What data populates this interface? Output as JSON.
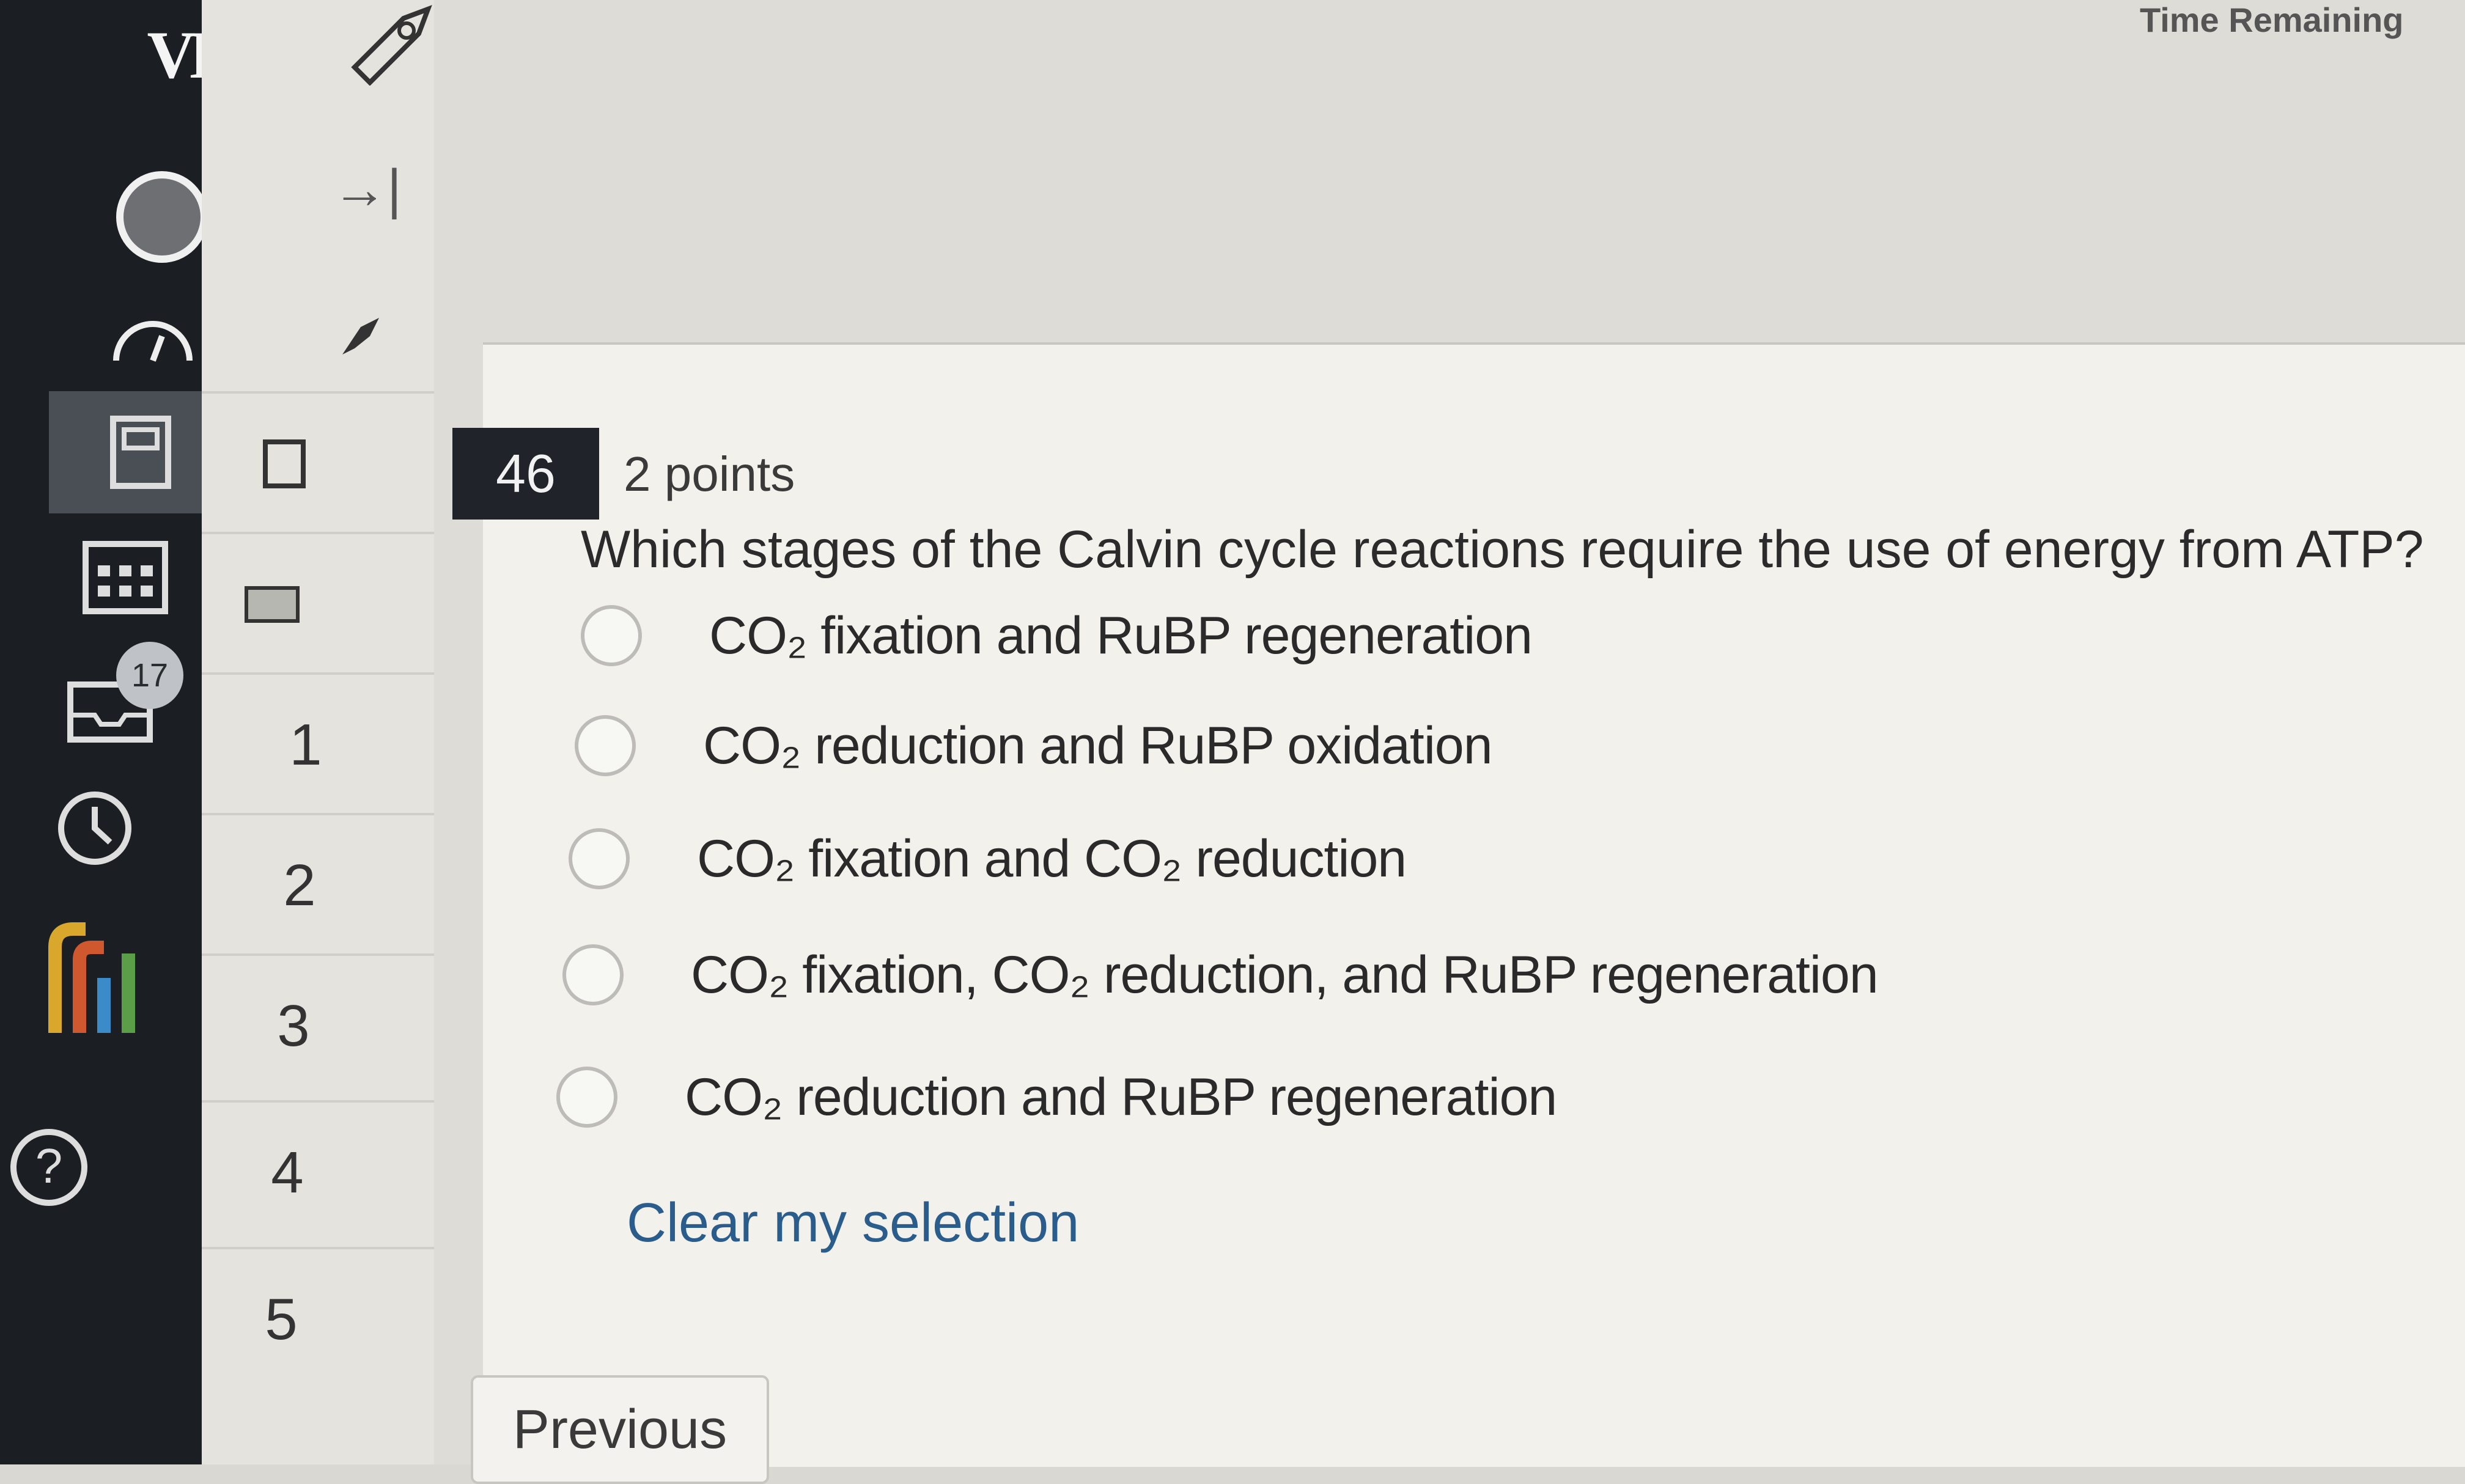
{
  "header": {
    "time_remaining_label": "Time Remaining"
  },
  "global_nav": {
    "logo_text": "VD",
    "inbox_badge_count": "17"
  },
  "course_nav": {
    "collapse_symbol": "→|",
    "question_numbers": [
      "1",
      "2",
      "3",
      "4",
      "5"
    ]
  },
  "question": {
    "number": "46",
    "points": "2 points",
    "text": "Which stages of the Calvin cycle reactions require the use of energy from ATP?",
    "answers": [
      "CO₂ fixation and RuBP regeneration",
      "CO₂ reduction and RuBP oxidation",
      "CO₂ fixation and CO₂ reduction",
      "CO₂ fixation, CO₂ reduction, and RuBP regeneration",
      "CO₂ reduction and RuBP regeneration"
    ],
    "clear_label": "Clear my selection"
  },
  "footer": {
    "previous_label": "Previous"
  }
}
